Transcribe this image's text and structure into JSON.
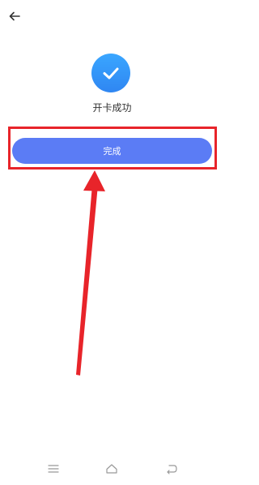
{
  "header": {
    "back_icon": "arrow-left-icon"
  },
  "status": {
    "icon": "checkmark-icon",
    "title": "开卡成功",
    "accent_color": "#2f86f2"
  },
  "actions": {
    "done_label": "完成",
    "button_color": "#5b7cf5"
  },
  "annotation": {
    "highlight_color": "#e8242a"
  },
  "system_nav": {
    "items": [
      "menu-icon",
      "home-icon",
      "back-icon"
    ]
  }
}
